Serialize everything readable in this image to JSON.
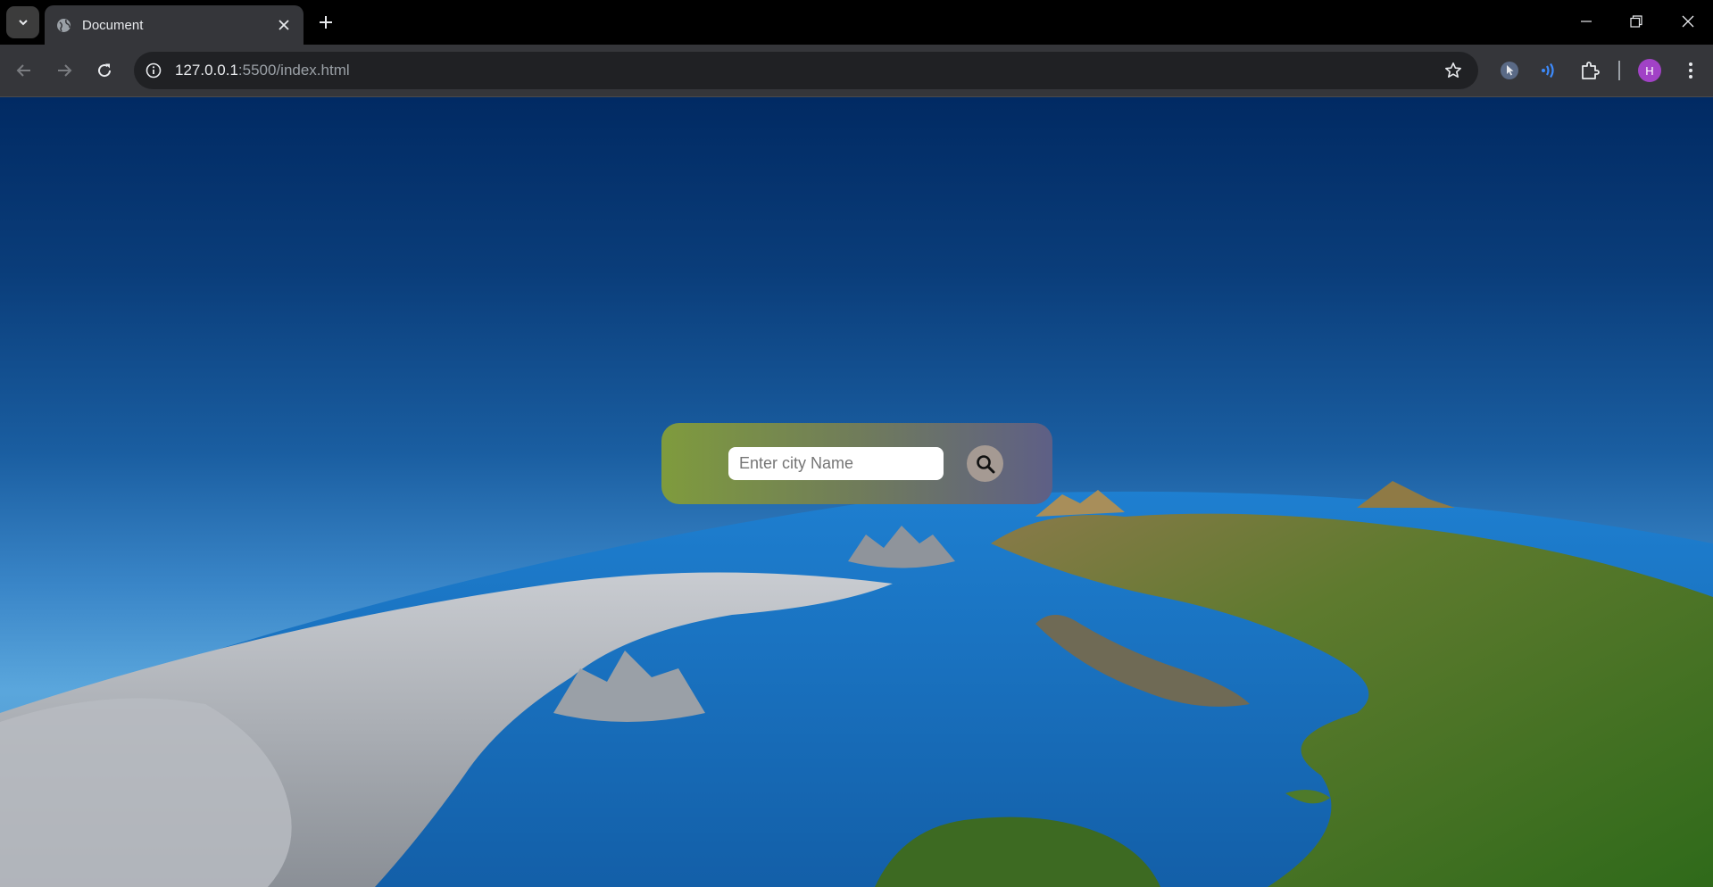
{
  "browser": {
    "tab": {
      "title": "Document"
    },
    "address": {
      "host": "127.0.0.1",
      "port_path": ":5500/index.html"
    },
    "profile_initial": "H",
    "colors": {
      "profile_avatar": "#a142c6",
      "extension_blue": "#3d8bfd"
    },
    "icons": [
      "tab-search-icon",
      "globe-icon",
      "close-icon",
      "plus-icon",
      "minimize-icon",
      "restore-icon",
      "window-close-icon",
      "back-icon",
      "forward-icon",
      "reload-icon",
      "info-icon",
      "star-icon",
      "cursor-extension-icon",
      "wave-extension-icon",
      "puzzle-icon",
      "kebab-menu-icon"
    ]
  },
  "weather_search": {
    "placeholder": "Enter city Name",
    "value": "",
    "search_icon": "search-icon",
    "colors": {
      "card_left": "#7f9b3d",
      "card_right": "#5e5f86",
      "button": "#a59a93"
    }
  }
}
